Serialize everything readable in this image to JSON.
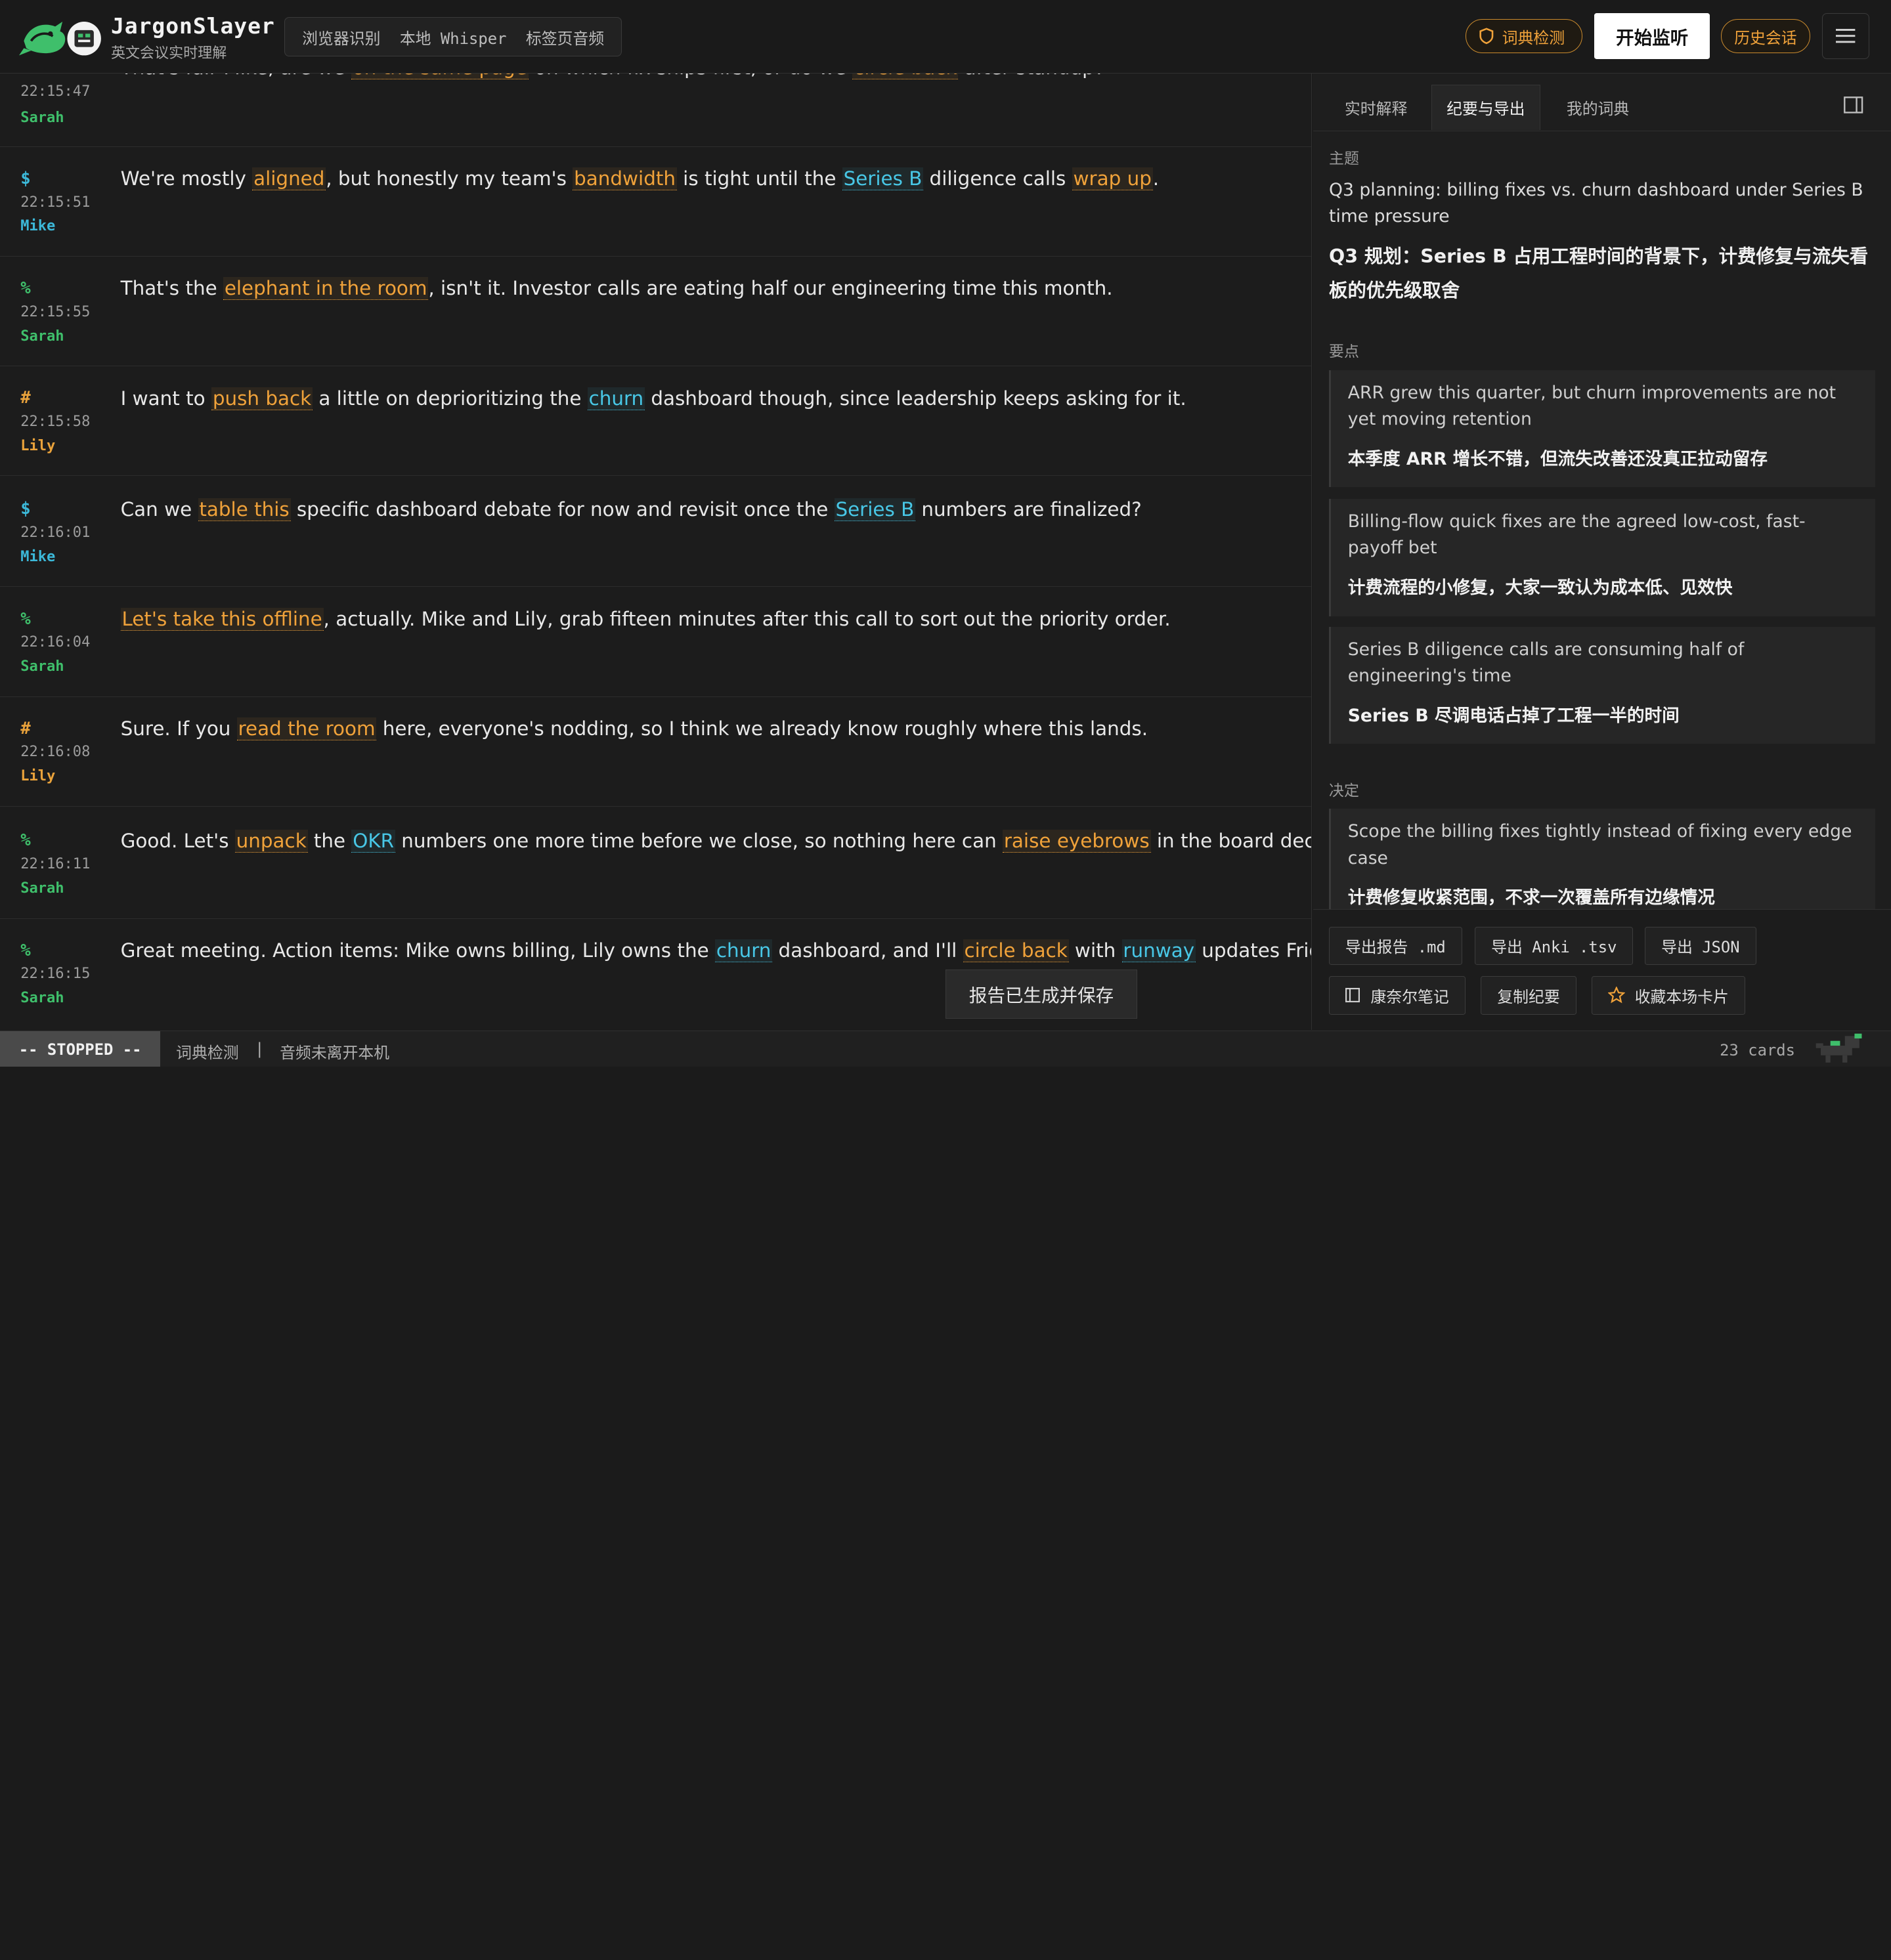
{
  "app": {
    "name": "JargonSlayer",
    "subtitle": "英文会议实时理解"
  },
  "header": {
    "mode_tabs": [
      "浏览器识别",
      "本地 Whisper",
      "标签页音频"
    ],
    "dict_check_label": "词典检测",
    "start_label": "开始监听",
    "history_label": "历史会话",
    "icons": {
      "dict": "shield-icon",
      "menu": "hamburger-icon"
    }
  },
  "transcript": {
    "partial_top": {
      "time": "22:15:47",
      "speaker": "Sarah",
      "pre": "That's fair Mike, are we ",
      "t1": "on the same page",
      "mid": " on which fix ships first, or do we ",
      "t2": "circle back",
      "post": " after standup?"
    },
    "rows": [
      {
        "sym": "$",
        "time": "22:15:51",
        "speaker": "Mike"
      },
      {
        "sym": "%",
        "time": "22:15:55",
        "speaker": "Sarah"
      },
      {
        "sym": "#",
        "time": "22:15:58",
        "speaker": "Lily"
      },
      {
        "sym": "$",
        "time": "22:16:01",
        "speaker": "Mike"
      },
      {
        "sym": "%",
        "time": "22:16:04",
        "speaker": "Sarah"
      },
      {
        "sym": "#",
        "time": "22:16:08",
        "speaker": "Lily"
      },
      {
        "sym": "%",
        "time": "22:16:11",
        "speaker": "Sarah"
      },
      {
        "sym": "%",
        "time": "22:16:15",
        "speaker": "Sarah"
      }
    ],
    "lines": {
      "r1": {
        "a": "We're mostly ",
        "b": "aligned",
        "c": ", but honestly my team's ",
        "d": "bandwidth",
        "e": " is tight until the ",
        "f": "Series B",
        "g": " diligence calls ",
        "h": "wrap up",
        "i": "."
      },
      "r2": {
        "a": "That's the ",
        "b": "elephant in the room",
        "c": ", isn't it. Investor calls are eating half our engineering time this month."
      },
      "r3": {
        "a": "I want to ",
        "b": "push back",
        "c": " a little on deprioritizing the ",
        "d": "churn",
        "e": " dashboard though, since leadership keeps asking for it."
      },
      "r4": {
        "a": "Can we ",
        "b": "table this",
        "c": " specific dashboard debate for now and revisit once the ",
        "d": "Series B",
        "e": " numbers are finalized?"
      },
      "r5": {
        "b": "Let's take this offline",
        "c": ", actually. Mike and Lily, grab fifteen minutes after this call to sort out the priority order."
      },
      "r6": {
        "a": "Sure. If you ",
        "b": "read the room",
        "c": " here, everyone's nodding, so I think we already know roughly where this lands."
      },
      "r7": {
        "a": "Good. Let's ",
        "b": "unpack",
        "c": " the ",
        "d": "OKR",
        "e": " numbers one more time before we close, so nothing here can ",
        "f": "raise eyebrows",
        "g": " in the board deck."
      },
      "r8": {
        "a": "Great meeting. Action items: Mike owns billing, Lily owns the ",
        "b": "churn",
        "c": " dashboard, and I'll ",
        "d": "circle back",
        "e": " with ",
        "f": "runway",
        "g": " updates Friday."
      }
    }
  },
  "panel": {
    "tabs": [
      "实时解释",
      "纪要与导出",
      "我的词典"
    ],
    "active_tab": "纪要与导出",
    "topic_label": "主题",
    "topic_en": "Q3 planning: billing fixes vs. churn dashboard under Series B time pressure",
    "topic_zh": "Q3 规划：Series B 占用工程时间的背景下，计费修复与流失看板的优先级取舍",
    "points_label": "要点",
    "points": [
      {
        "en": "ARR grew this quarter, but churn improvements are not yet moving retention",
        "zh": "本季度 ARR 增长不错，但流失改善还没真正拉动留存"
      },
      {
        "en": "Billing-flow quick fixes are the agreed low-cost, fast-payoff bet",
        "zh": "计费流程的小修复，大家一致认为成本低、见效快"
      },
      {
        "en": "Series B diligence calls are consuming half of engineering's time",
        "zh": "Series B 尽调电话占掉了工程一半的时间"
      }
    ],
    "decisions_label": "决定",
    "decisions": [
      {
        "en": "Scope the billing fixes tightly instead of fixing every edge case",
        "zh": "计费修复收紧范围，不求一次覆盖所有边缘情况"
      }
    ],
    "footer": {
      "export_md": "导出报告 .md",
      "export_anki": "导出 Anki .tsv",
      "export_json": "导出 JSON",
      "cornell": "康奈尔笔记",
      "copy_minutes": "复制纪要",
      "favorite": "收藏本场卡片"
    }
  },
  "toast": "报告已生成并保存",
  "status": {
    "state": "-- STOPPED --",
    "dict_check": "词典检测",
    "separator": "|",
    "audio_note": "音频未离开本机",
    "cards": "23 cards"
  },
  "colors": {
    "sarah": "#3fbf6b",
    "mike": "#3cb8d8",
    "lily": "#e9a23b",
    "jargon": "#f0a23a",
    "term": "#48c7e6"
  }
}
